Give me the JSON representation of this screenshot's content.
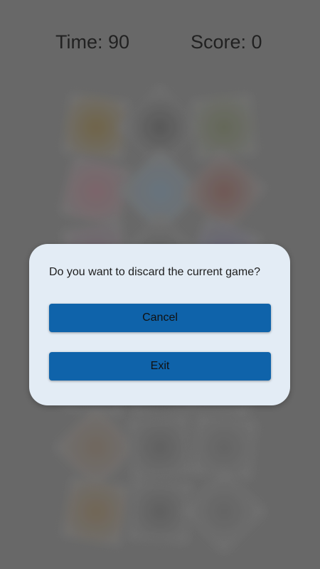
{
  "hud": {
    "time_text": "Time: 90",
    "score_text": "Score: 0"
  },
  "board": {
    "tiles": [
      {
        "color": "#7a6a45",
        "rot": 8
      },
      {
        "color": "#5a5a5a",
        "rot": 45
      },
      {
        "color": "#6a6f5a",
        "rot": -6
      },
      {
        "color": "#8a6a72",
        "rot": 14
      },
      {
        "color": "#6e7f8c",
        "rot": 45
      },
      {
        "color": "#7a5a55",
        "rot": 40
      },
      {
        "color": "#7a6a75",
        "rot": -10
      },
      {
        "color": "#666666",
        "rot": 45
      },
      {
        "color": "#6d6a80",
        "rot": 20
      },
      {
        "color": "#6a6a6a",
        "rot": 10
      },
      {
        "color": "#5f5f5f",
        "rot": -8
      },
      {
        "color": "#6b6b6b",
        "rot": 12
      },
      {
        "color": "#7a6e62",
        "rot": 45
      },
      {
        "color": "#656565",
        "rot": -5
      },
      {
        "color": "#6a6a6a",
        "rot": 6
      },
      {
        "color": "#7b6c56",
        "rot": 10
      },
      {
        "color": "#646464",
        "rot": 4
      },
      {
        "color": "#6a6a6a",
        "rot": 45
      }
    ]
  },
  "dialog": {
    "message": "Do you want to discard the current game?",
    "cancel_label": "Cancel",
    "exit_label": "Exit",
    "button_color": "#0f63aa",
    "dialog_bg": "#e3ecf5"
  }
}
